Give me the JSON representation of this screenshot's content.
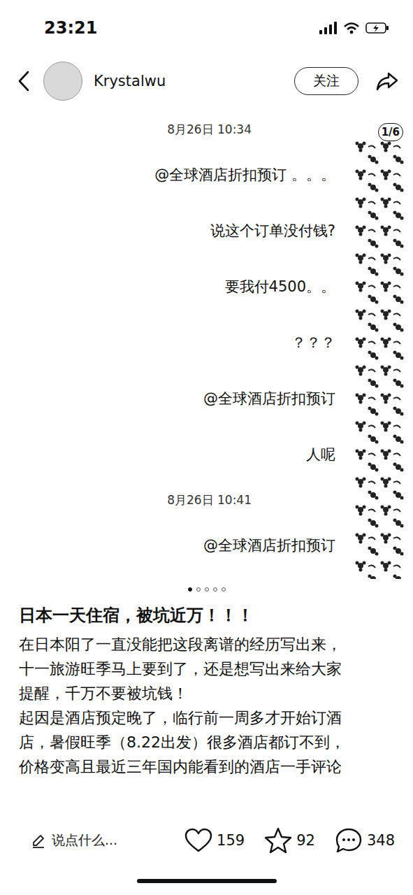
{
  "status_bar": {
    "time": "23:21"
  },
  "header": {
    "username": "Krystalwu",
    "follow_button": "关注"
  },
  "gallery": {
    "counter": "1/6",
    "messages": [
      {
        "kind": "timestamp",
        "text": "8月26日 10:34"
      },
      {
        "kind": "message",
        "text": "@全球酒店折扣预订 。。。"
      },
      {
        "kind": "message",
        "text": "说这个订单没付钱?"
      },
      {
        "kind": "message",
        "text": "要我付4500。。"
      },
      {
        "kind": "message",
        "text": "？？？"
      },
      {
        "kind": "message",
        "text": "@全球酒店折扣预订"
      },
      {
        "kind": "message",
        "text": "人呢"
      },
      {
        "kind": "timestamp",
        "text": "8月26日 10:41"
      },
      {
        "kind": "message",
        "text": "@全球酒店折扣预订"
      }
    ],
    "dots": [
      {
        "selected": true
      },
      {
        "selected": false
      },
      {
        "selected": false
      },
      {
        "selected": false
      },
      {
        "selected": false
      }
    ]
  },
  "post": {
    "title": "日本一天住宿，被坑近万！！！",
    "body_lines": [
      "在日本阳了一直没能把这段离谱的经历写出来，",
      "十一旅游旺季马上要到了，还是想写出来给大家",
      "提醒，千万不要被坑钱！",
      "起因是酒店预定晚了，临行前一周多才开始订酒",
      "店，暑假旺季（8.22出发）很多酒店都订不到，",
      "价格变高且最近三年国内能看到的酒店一手评论"
    ]
  },
  "action_bar": {
    "comment_placeholder": "说点什么...",
    "likes": "159",
    "favorites": "92",
    "comments": "348"
  }
}
